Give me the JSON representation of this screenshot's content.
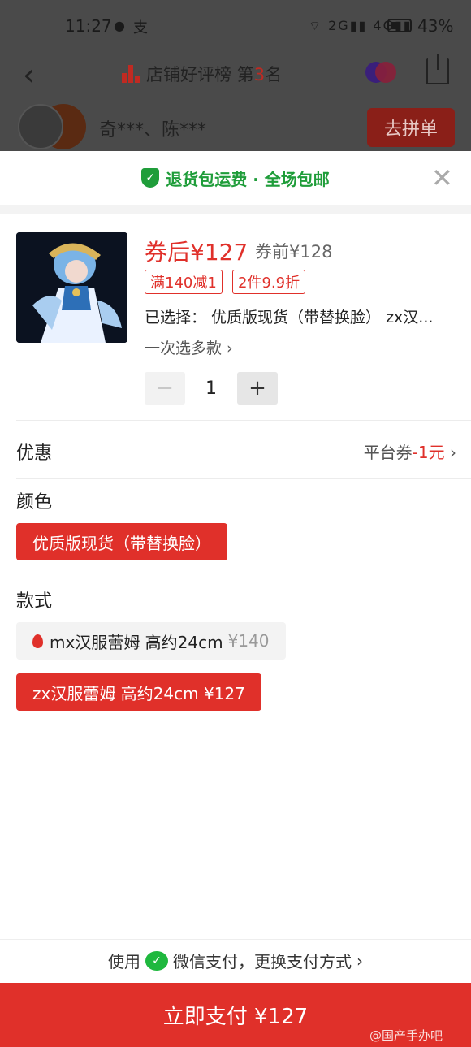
{
  "status_bar": {
    "time": "11:27",
    "wechat_glyph": "●",
    "other_glyph": "支",
    "signal_text": "⌔ 2G▮▮ 4G▮▮",
    "battery_percent": "43%"
  },
  "topbar": {
    "back_glyph": "‹",
    "rank_prefix": "店铺好评榜 第",
    "rank_number": "3",
    "rank_suffix": "名"
  },
  "group": {
    "names": "奇***、陈***",
    "button_label": "去拼单"
  },
  "sheet": {
    "banner_text": "退货包运费 · 全场包邮",
    "close_glyph": "✕",
    "product": {
      "price_after": "券后¥127",
      "price_before": "券前¥128",
      "tags": [
        "满140减1",
        "2件9.9折"
      ],
      "selected_text": "已选择：  优质版现货（带替换脸） zx汉...",
      "multi_select": "一次选多款 ›",
      "quantity": "1",
      "minus_glyph": "−",
      "plus_glyph": "+"
    },
    "promo": {
      "label": "优惠",
      "right_prefix": "平台券",
      "right_value": "-1元",
      "chevron": "›"
    },
    "color": {
      "label": "颜色",
      "options": [
        {
          "label": "优质版现货（带替换脸）",
          "selected": true
        }
      ]
    },
    "style": {
      "label": "款式",
      "options": [
        {
          "name": "mx汉服蕾姆 高约24cm",
          "price": "¥140",
          "selected": false
        },
        {
          "name": "zx汉服蕾姆 高约24cm ¥127",
          "selected": true
        }
      ]
    },
    "pay": {
      "prefix": "使用",
      "method": "微信支付，更换支付方式",
      "chevron": "›",
      "button_label": "立即支付 ¥127"
    },
    "watermark": "@国产手办吧"
  },
  "colors": {
    "accent": "#e0302a",
    "green": "#1f9d3a",
    "wechat": "#1fb83e"
  }
}
